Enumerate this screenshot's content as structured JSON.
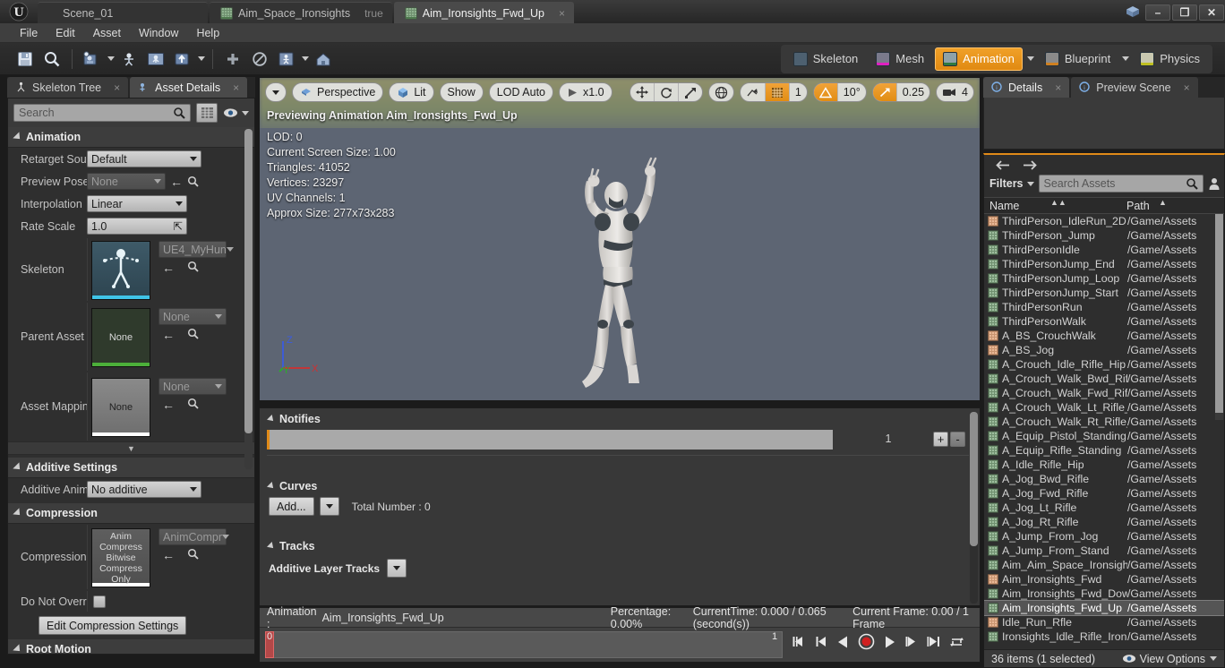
{
  "window": {
    "app_logo": "unreal-logo",
    "minimize": "–",
    "maximize": "❐",
    "close": "✕"
  },
  "tabs": [
    {
      "label": "Scene_01",
      "active": false,
      "icon": null,
      "closable": false
    },
    {
      "label": "Aim_Space_Ironsights",
      "active": false,
      "icon": "animation-asset-icon",
      "closable": true
    },
    {
      "label": "Aim_Ironsights_Fwd_Up",
      "active": true,
      "icon": "animation-asset-icon",
      "closable": true
    }
  ],
  "menu": [
    "File",
    "Edit",
    "Asset",
    "Window",
    "Help"
  ],
  "toolbar": {
    "left_buttons": [
      "save-icon",
      "browse-icon",
      "reimport-icon",
      "apply-compression-icon",
      "export-icon",
      "record-icon"
    ],
    "mid_buttons": [
      "add-icon",
      "no-entry-icon",
      "preview-mesh-icon",
      "home-icon"
    ],
    "modes": [
      {
        "label": "Skeleton",
        "active": false
      },
      {
        "label": "Mesh",
        "active": false
      },
      {
        "label": "Animation",
        "active": true
      },
      {
        "label": "Blueprint",
        "active": false
      },
      {
        "label": "Physics",
        "active": false
      }
    ]
  },
  "left_panel": {
    "tabs": [
      {
        "label": "Skeleton Tree",
        "active": false
      },
      {
        "label": "Asset Details",
        "active": true
      }
    ],
    "search_placeholder": "Search",
    "sections": [
      {
        "title": "Animation",
        "rows": [
          {
            "label": "Retarget Sour",
            "type": "combo",
            "value": "Default"
          },
          {
            "label": "Preview Pose",
            "type": "combo_dim_with_tools",
            "value": "None"
          },
          {
            "label": "Interpolation",
            "type": "combo",
            "value": "Linear"
          },
          {
            "label": "Rate Scale",
            "type": "number",
            "value": "1.0"
          },
          {
            "label": "Skeleton",
            "type": "asset",
            "value": "UE4_MyHun",
            "thumb_label": ""
          },
          {
            "label": "Parent Asset",
            "type": "asset",
            "value": "None",
            "thumb_label": "None"
          },
          {
            "label": "Asset Mapping",
            "type": "asset",
            "value": "None",
            "thumb_label": "None"
          }
        ]
      },
      {
        "title": "Additive Settings",
        "rows": [
          {
            "label": "Additive Anim",
            "type": "combo",
            "value": "No additive"
          }
        ]
      },
      {
        "title": "Compression",
        "rows": [
          {
            "label": "Compression S",
            "type": "asset",
            "value": "AnimCompr",
            "thumb_label": "Anim Compress Bitwise Compress Only"
          },
          {
            "label": "Do Not Overric",
            "type": "checkbox",
            "value": ""
          }
        ],
        "button": "Edit Compression Settings"
      },
      {
        "title": "Root Motion",
        "rows": []
      }
    ]
  },
  "viewport": {
    "view_mode": "Perspective",
    "lighting": "Lit",
    "show": "Show",
    "lod": "LOD Auto",
    "playrate": "x1.0",
    "grid_snap": "1",
    "angle_snap": "10°",
    "scale_snap": "0.25",
    "camera_speed": "4",
    "stats": {
      "header": "Previewing Animation Aim_Ironsights_Fwd_Up",
      "lod": "LOD: 0",
      "screen_size": "Current Screen Size: 1.00",
      "triangles": "Triangles: 41052",
      "vertices": "Vertices: 23297",
      "uv_channels": "UV Channels: 1",
      "approx_size": "Approx Size: 277x73x283"
    },
    "gizmo_axes": {
      "x": "X",
      "y": "Y",
      "z": "Z"
    }
  },
  "anim_editor": {
    "notifies_title": "Notifies",
    "notifies_count": "1",
    "add_track": "+",
    "remove_track": "-",
    "curves_title": "Curves",
    "curves_add": "Add...",
    "curves_total": "Total Number : 0",
    "tracks_title": "Tracks",
    "additive_layer_tracks": "Additive Layer Tracks"
  },
  "timeline": {
    "animation_label": "Animation :",
    "animation_name": "Aim_Ironsights_Fwd_Up",
    "percentage": "Percentage:  0.00%",
    "current_time": "CurrentTime:  0.000 / 0.065 (second(s))",
    "current_frame": "Current Frame:  0.00 / 1 Frame",
    "range_start": "0",
    "range_end": "1",
    "transport": [
      "skip-back-icon",
      "step-back-icon",
      "play-reverse-icon",
      "record-icon",
      "play-icon",
      "step-forward-icon",
      "skip-forward-icon",
      "loop-icon"
    ]
  },
  "right_panel": {
    "tabs": [
      {
        "label": "Details",
        "active": true
      },
      {
        "label": "Preview Scene",
        "active": false
      }
    ],
    "asset_browser": {
      "filters_label": "Filters",
      "search_placeholder": "Search Assets",
      "columns": [
        "Name",
        "Path"
      ],
      "status": "36 items (1 selected)",
      "view_options": "View Options",
      "rows": [
        {
          "name": "ThirdPerson_IdleRun_2D",
          "path": "/Game/Assets",
          "kind": "blendspace",
          "selected": false
        },
        {
          "name": "ThirdPerson_Jump",
          "path": "/Game/Assets",
          "kind": "animation",
          "selected": false
        },
        {
          "name": "ThirdPersonIdle",
          "path": "/Game/Assets",
          "kind": "animation",
          "selected": false
        },
        {
          "name": "ThirdPersonJump_End",
          "path": "/Game/Assets",
          "kind": "animation",
          "selected": false
        },
        {
          "name": "ThirdPersonJump_Loop",
          "path": "/Game/Assets",
          "kind": "animation",
          "selected": false
        },
        {
          "name": "ThirdPersonJump_Start",
          "path": "/Game/Assets",
          "kind": "animation",
          "selected": false
        },
        {
          "name": "ThirdPersonRun",
          "path": "/Game/Assets",
          "kind": "animation",
          "selected": false
        },
        {
          "name": "ThirdPersonWalk",
          "path": "/Game/Assets",
          "kind": "animation",
          "selected": false
        },
        {
          "name": "A_BS_CrouchWalk",
          "path": "/Game/Assets",
          "kind": "blendspace",
          "selected": false
        },
        {
          "name": "A_BS_Jog",
          "path": "/Game/Assets",
          "kind": "blendspace",
          "selected": false
        },
        {
          "name": "A_Crouch_Idle_Rifle_Hip",
          "path": "/Game/Assets",
          "kind": "animation",
          "selected": false
        },
        {
          "name": "A_Crouch_Walk_Bwd_Rifl",
          "path": "/Game/Assets",
          "kind": "animation",
          "selected": false
        },
        {
          "name": "A_Crouch_Walk_Fwd_Rifl",
          "path": "/Game/Assets",
          "kind": "animation",
          "selected": false
        },
        {
          "name": "A_Crouch_Walk_Lt_Rifle_",
          "path": "/Game/Assets",
          "kind": "animation",
          "selected": false
        },
        {
          "name": "A_Crouch_Walk_Rt_Rifle_",
          "path": "/Game/Assets",
          "kind": "animation",
          "selected": false
        },
        {
          "name": "A_Equip_Pistol_Standing",
          "path": "/Game/Assets",
          "kind": "animation",
          "selected": false
        },
        {
          "name": "A_Equip_Rifle_Standing",
          "path": "/Game/Assets",
          "kind": "animation",
          "selected": false
        },
        {
          "name": "A_Idle_Rifle_Hip",
          "path": "/Game/Assets",
          "kind": "animation",
          "selected": false
        },
        {
          "name": "A_Jog_Bwd_Rifle",
          "path": "/Game/Assets",
          "kind": "animation",
          "selected": false
        },
        {
          "name": "A_Jog_Fwd_Rifle",
          "path": "/Game/Assets",
          "kind": "animation",
          "selected": false
        },
        {
          "name": "A_Jog_Lt_Rifle",
          "path": "/Game/Assets",
          "kind": "animation",
          "selected": false
        },
        {
          "name": "A_Jog_Rt_Rifle",
          "path": "/Game/Assets",
          "kind": "animation",
          "selected": false
        },
        {
          "name": "A_Jump_From_Jog",
          "path": "/Game/Assets",
          "kind": "animation",
          "selected": false
        },
        {
          "name": "A_Jump_From_Stand",
          "path": "/Game/Assets",
          "kind": "animation",
          "selected": false
        },
        {
          "name": "Aim_Aim_Space_Ironsigh",
          "path": "/Game/Assets",
          "kind": "animation",
          "selected": false
        },
        {
          "name": "Aim_Ironsights_Fwd",
          "path": "/Game/Assets",
          "kind": "blendspace",
          "selected": false
        },
        {
          "name": "Aim_Ironsights_Fwd_Dow",
          "path": "/Game/Assets",
          "kind": "animation",
          "selected": false
        },
        {
          "name": "Aim_Ironsights_Fwd_Up",
          "path": "/Game/Assets",
          "kind": "animation",
          "selected": true
        },
        {
          "name": "Idle_Run_Rfle",
          "path": "/Game/Assets",
          "kind": "blendspace",
          "selected": false
        },
        {
          "name": "Ironsights_Idle_Rifle_Iron",
          "path": "/Game/Assets",
          "kind": "animation",
          "selected": false
        }
      ]
    }
  },
  "colors": {
    "accent_orange": "#e08a18",
    "panel_bg": "#2b2b2b",
    "viewport_bg": "#5a6270",
    "selection": "#555555"
  }
}
